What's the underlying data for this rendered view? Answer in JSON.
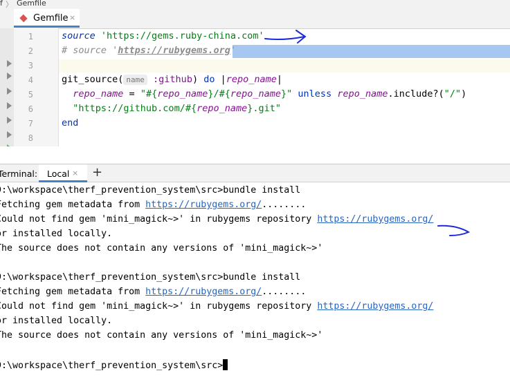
{
  "breadcrumb": {
    "root": "f",
    "separator": "〉",
    "file": "Gemfile"
  },
  "editor": {
    "tab_label": "Gemfile",
    "tab_close": "×",
    "line_numbers": [
      "1",
      "2",
      "3",
      "4",
      "5",
      "6",
      "7",
      "8"
    ],
    "lines": {
      "l1": {
        "kw": "source",
        "str": " 'https://gems.ruby-china.com'"
      },
      "l2": {
        "hash": "# source '",
        "link": "https://rubygems.org",
        "end": "'"
      },
      "l4": {
        "a": "git_source(",
        "hint": "name",
        "b": ":github",
        "c": ") ",
        "d": "do",
        "e": " |",
        "f": "repo_name",
        "g": "|"
      },
      "l5": {
        "a": "  ",
        "b": "repo_name",
        "c": " = ",
        "d": "\"#{",
        "e": "repo_name",
        "f": "}/#{",
        "g": "repo_name",
        "h": "}\"",
        "i": " unless ",
        "j": "repo_name",
        "k": ".include?(",
        "l": "\"/\"",
        "m": ")"
      },
      "l6": {
        "a": "  ",
        "b": "\"https://github.com/#{",
        "c": "repo_name",
        "d": "}.git\""
      },
      "l7": {
        "a": "end"
      }
    }
  },
  "terminal": {
    "label": "Terminal:",
    "tab_label": "Local",
    "tab_close": "×",
    "add_label": "+",
    "lines": [
      {
        "t": "D:\\workspace\\therf_prevention_system\\src>bundle install"
      },
      {
        "t": "Fetching gem metadata from ",
        "link": "https://rubygems.org/",
        "after": "........"
      },
      {
        "t": "Could not find gem 'mini_magick~>' in rubygems repository ",
        "link": "https://rubygems.org/"
      },
      {
        "t": "or installed locally."
      },
      {
        "t": "The source does not contain any versions of 'mini_magick~>'"
      },
      {
        "t": ""
      },
      {
        "t": "D:\\workspace\\therf_prevention_system\\src>bundle install"
      },
      {
        "t": "Fetching gem metadata from ",
        "link": "https://rubygems.org/",
        "after": "........"
      },
      {
        "t": "Could not find gem 'mini_magick~>' in rubygems repository ",
        "link": "https://rubygems.org/"
      },
      {
        "t": "or installed locally."
      },
      {
        "t": "The source does not contain any versions of 'mini_magick~>'"
      },
      {
        "t": ""
      },
      {
        "t": "D:\\workspace\\therf_prevention_system\\src>"
      }
    ]
  },
  "colors": {
    "annotation": "#1a2bd6",
    "selection": "#a6c8f0",
    "accent": "#4083c9"
  }
}
